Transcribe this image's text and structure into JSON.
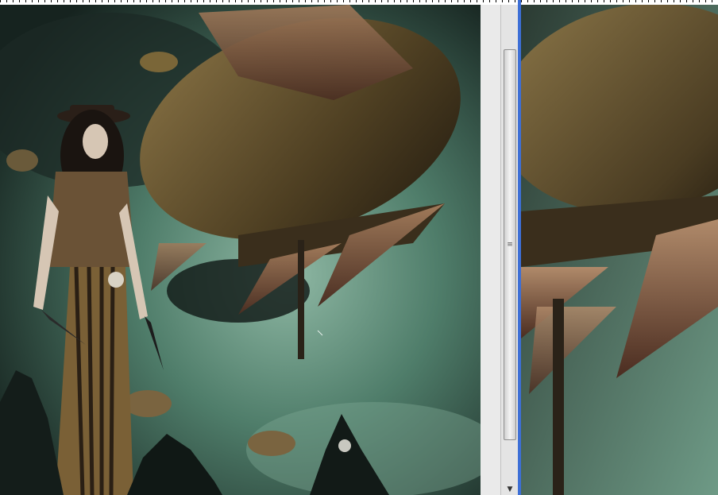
{
  "window": {
    "description_free": true
  },
  "left_pane": {
    "scene_icon": "artwork-canvas-icon"
  },
  "right_pane": {
    "scene_icon": "artwork-zoom-canvas-icon"
  },
  "scrollbar": {
    "grip_glyph": "≡",
    "down_arrow": "▼"
  },
  "colors": {
    "sky_green": "#5a8a74",
    "sky_dark": "#1e2e28",
    "airship_brown": "#5b4a2a",
    "divider_blue": "#3d6fd6"
  }
}
